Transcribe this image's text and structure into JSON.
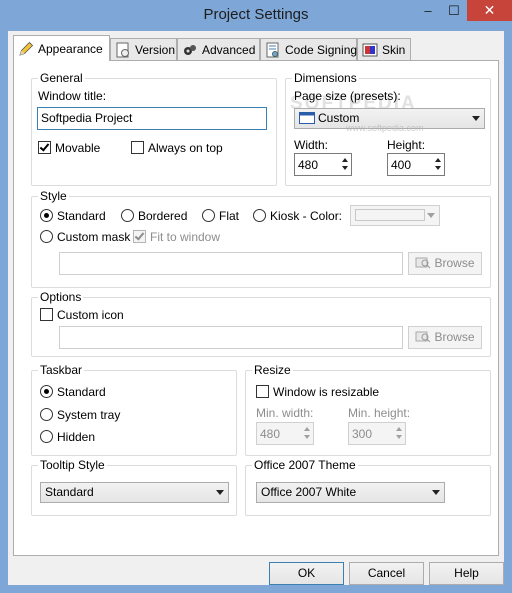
{
  "window": {
    "title": "Project Settings",
    "minimize": "–",
    "maximize": "☐",
    "close": "✕"
  },
  "tabs": [
    {
      "label": "Appearance",
      "icon": "pencil-icon"
    },
    {
      "label": "Version",
      "icon": "version-icon"
    },
    {
      "label": "Advanced",
      "icon": "gears-icon"
    },
    {
      "label": "Code Signing",
      "icon": "certificate-icon"
    },
    {
      "label": "Skin",
      "icon": "skin-icon"
    }
  ],
  "general": {
    "legend": "General",
    "window_title_label": "Window title:",
    "window_title_value": "Softpedia Project",
    "movable_label": "Movable",
    "movable_checked": true,
    "always_on_top_label": "Always on top",
    "always_on_top_checked": false
  },
  "dimensions": {
    "legend": "Dimensions",
    "page_size_label": "Page size (presets):",
    "page_size_value": "Custom",
    "width_label": "Width:",
    "width_value": "480",
    "height_label": "Height:",
    "height_value": "400"
  },
  "watermark": {
    "text": "SOFTPEDIA",
    "sub": "www.softpedia.com"
  },
  "style": {
    "legend": "Style",
    "options": [
      "Standard",
      "Bordered",
      "Flat",
      "Kiosk - Color:"
    ],
    "selected": "Standard",
    "custom_mask_label": "Custom mask",
    "fit_to_window_label": "Fit to window",
    "fit_to_window_checked": true,
    "mask_path": "",
    "browse_label": "Browse"
  },
  "options": {
    "legend": "Options",
    "custom_icon_label": "Custom icon",
    "custom_icon_checked": false,
    "icon_path": "",
    "browse_label": "Browse"
  },
  "taskbar": {
    "legend": "Taskbar",
    "options": [
      "Standard",
      "System tray",
      "Hidden"
    ],
    "selected": "Standard"
  },
  "resize": {
    "legend": "Resize",
    "resizable_label": "Window is resizable",
    "resizable_checked": false,
    "min_width_label": "Min. width:",
    "min_width_value": "480",
    "min_height_label": "Min. height:",
    "min_height_value": "300"
  },
  "tooltip_style": {
    "legend": "Tooltip Style",
    "value": "Standard"
  },
  "office_theme": {
    "legend": "Office 2007 Theme",
    "value": "Office 2007 White"
  },
  "footer": {
    "ok": "OK",
    "cancel": "Cancel",
    "help": "Help"
  },
  "colors": {
    "titlebar": "#7ea7d8",
    "close": "#c7443a",
    "focus": "#3c7fb1"
  }
}
